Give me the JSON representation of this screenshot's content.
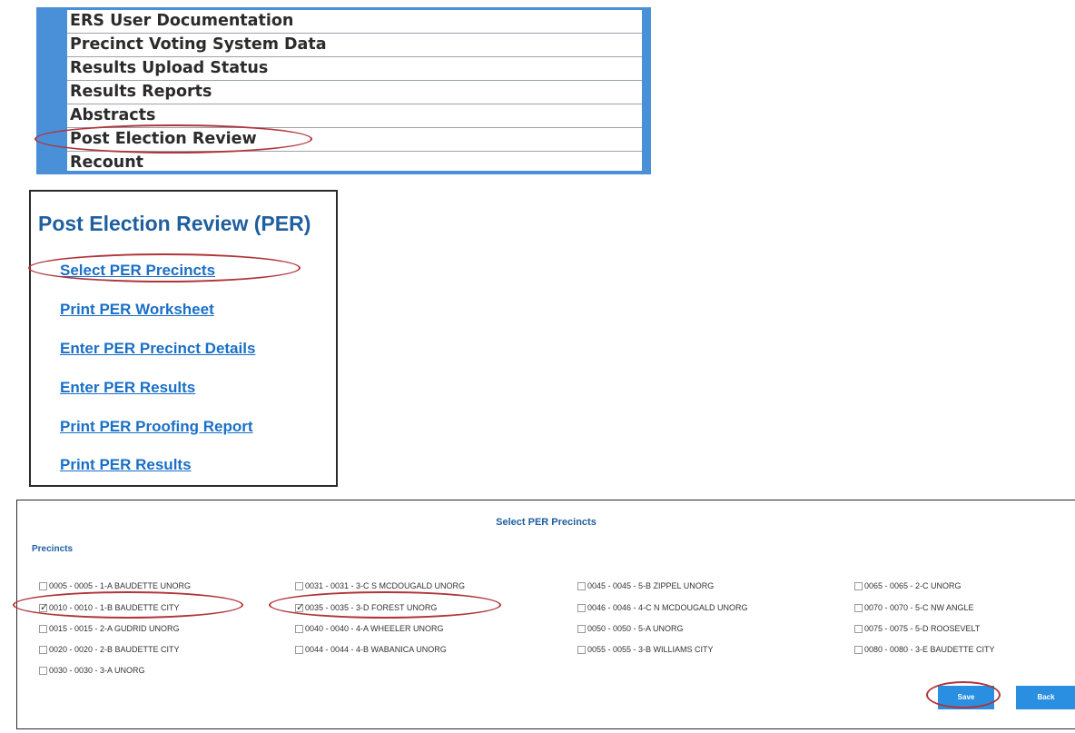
{
  "menu": {
    "items": [
      {
        "label": "ERS User Documentation"
      },
      {
        "label": "Precinct Voting System Data"
      },
      {
        "label": "Results Upload Status"
      },
      {
        "label": "Results Reports"
      },
      {
        "label": "Abstracts"
      },
      {
        "label": "Post Election Review"
      },
      {
        "label": "Recount"
      }
    ],
    "highlighted": "Post Election Review"
  },
  "per_panel": {
    "title": "Post Election Review (PER)",
    "links": [
      {
        "label": "Select PER Precincts"
      },
      {
        "label": "Print PER Worksheet"
      },
      {
        "label": "Enter PER Precinct Details"
      },
      {
        "label": "Enter PER Results"
      },
      {
        "label": "Print PER Proofing Report"
      },
      {
        "label": "Print PER Results"
      }
    ],
    "highlighted": "Select PER Precincts"
  },
  "select_panel": {
    "title": "Select PER Precincts",
    "section_label": "Precincts",
    "precincts": [
      {
        "label": "0005 - 0005 - 1-A BAUDETTE UNORG",
        "checked": false
      },
      {
        "label": "0010 - 0010 - 1-B BAUDETTE CITY",
        "checked": true
      },
      {
        "label": "0015 - 0015 - 2-A GUDRID UNORG",
        "checked": false
      },
      {
        "label": "0020 - 0020 - 2-B BAUDETTE CITY",
        "checked": false
      },
      {
        "label": "0030 - 0030 - 3-A UNORG",
        "checked": false
      },
      {
        "label": "0031 - 0031 - 3-C S MCDOUGALD UNORG",
        "checked": false
      },
      {
        "label": "0035 - 0035 - 3-D FOREST UNORG",
        "checked": true
      },
      {
        "label": "0040 - 0040 - 4-A WHEELER UNORG",
        "checked": false
      },
      {
        "label": "0044 - 0044 - 4-B WABANICA UNORG",
        "checked": false
      },
      {
        "label": "0045 - 0045 - 5-B ZIPPEL UNORG",
        "checked": false
      },
      {
        "label": "0046 - 0046 - 4-C N MCDOUGALD UNORG",
        "checked": false
      },
      {
        "label": "0050 - 0050 - 5-A UNORG",
        "checked": false
      },
      {
        "label": "0055 - 0055 - 3-B WILLIAMS CITY",
        "checked": false
      },
      {
        "label": "0065 - 0065 - 2-C UNORG",
        "checked": false
      },
      {
        "label": "0070 - 0070 - 5-C NW ANGLE",
        "checked": false
      },
      {
        "label": "0075 - 0075 - 5-D ROOSEVELT",
        "checked": false
      },
      {
        "label": "0080 - 0080 - 3-E BAUDETTE CITY",
        "checked": false
      }
    ],
    "save_label": "Save",
    "back_label": "Back"
  },
  "colors": {
    "menu_bar": "#4a90d9",
    "heading_blue": "#1f5f9f",
    "link_blue": "#1a6fc6",
    "button_blue": "#2a8fe0",
    "annotation_red": "#b0343a"
  }
}
